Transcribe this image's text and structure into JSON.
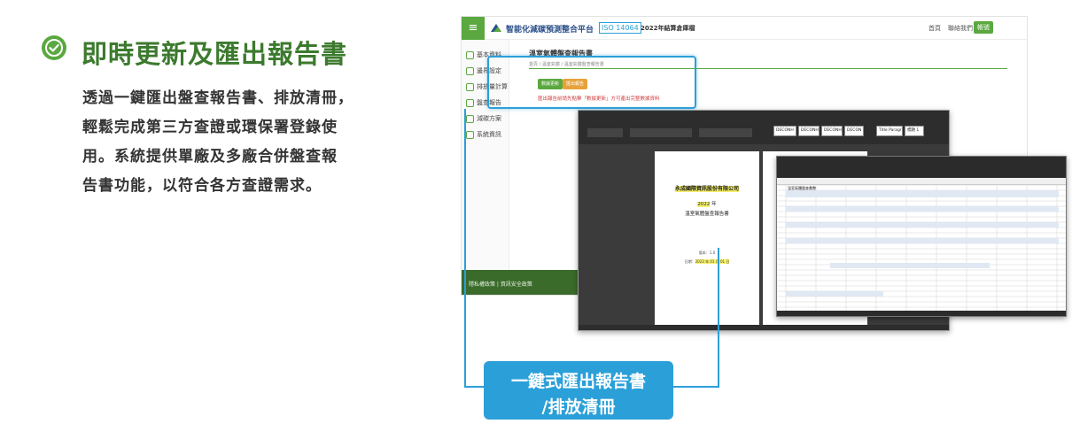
{
  "feature": {
    "title": "即時更新及匯出報告書",
    "description_lines": [
      "透過一鍵匯出盤查報告書、排放清冊，",
      "輕鬆完成第三方查證或環保署登錄使",
      "用。系統提供單廠及多廠合併盤查報",
      "告書功能，以符合各方查證需求。"
    ],
    "icon": "check-circle-icon"
  },
  "app": {
    "title": "智能化減碳預測整合平台",
    "iso_badge": "ISO 14064",
    "year_label": "2022年結算倉庫檔",
    "nav": {
      "home": "首頁",
      "contact": "聯絡我們",
      "account": "帳號"
    },
    "sidebar_items": [
      "基本資料",
      "邊界設定",
      "排放量計算",
      "盤查報告",
      "減碳方案",
      "系統資訊"
    ],
    "footer_text": "隱私權政策 | 資訊安全政策",
    "page_title": "溫室氣體盤查報告書",
    "breadcrumb": "首頁 / 溫室氣體 / 溫室氣體盤查報告書",
    "buttons": {
      "update": "數據更新",
      "export": "匯出報告"
    },
    "hint": "匯出報告前請先點擊「數據更新」方可產出完整數據資料"
  },
  "word_doc": {
    "style_boxes": [
      "DECONH",
      "DECONH",
      "DECONH",
      "DECON",
      "Title Paragraph",
      "標題 1"
    ],
    "company": "永成國際資訊股份有限公司",
    "year": "2022",
    "year_suffix": "年",
    "report_name": "溫室氣體盤查報告書",
    "version": "版本：1.0",
    "date_label": "日期：",
    "date_value": "2023 年 01 月 01 日"
  },
  "excel": {
    "sheet_title": "溫室氣體盤查彙整"
  },
  "callout": {
    "line1": "一鍵式匯出報告書",
    "line2": "/排放清冊"
  },
  "colors": {
    "brand_green": "#5aa83f",
    "title_green": "#3c7a2e",
    "callout_blue": "#2b9fd8",
    "export_orange": "#e8a23a"
  }
}
